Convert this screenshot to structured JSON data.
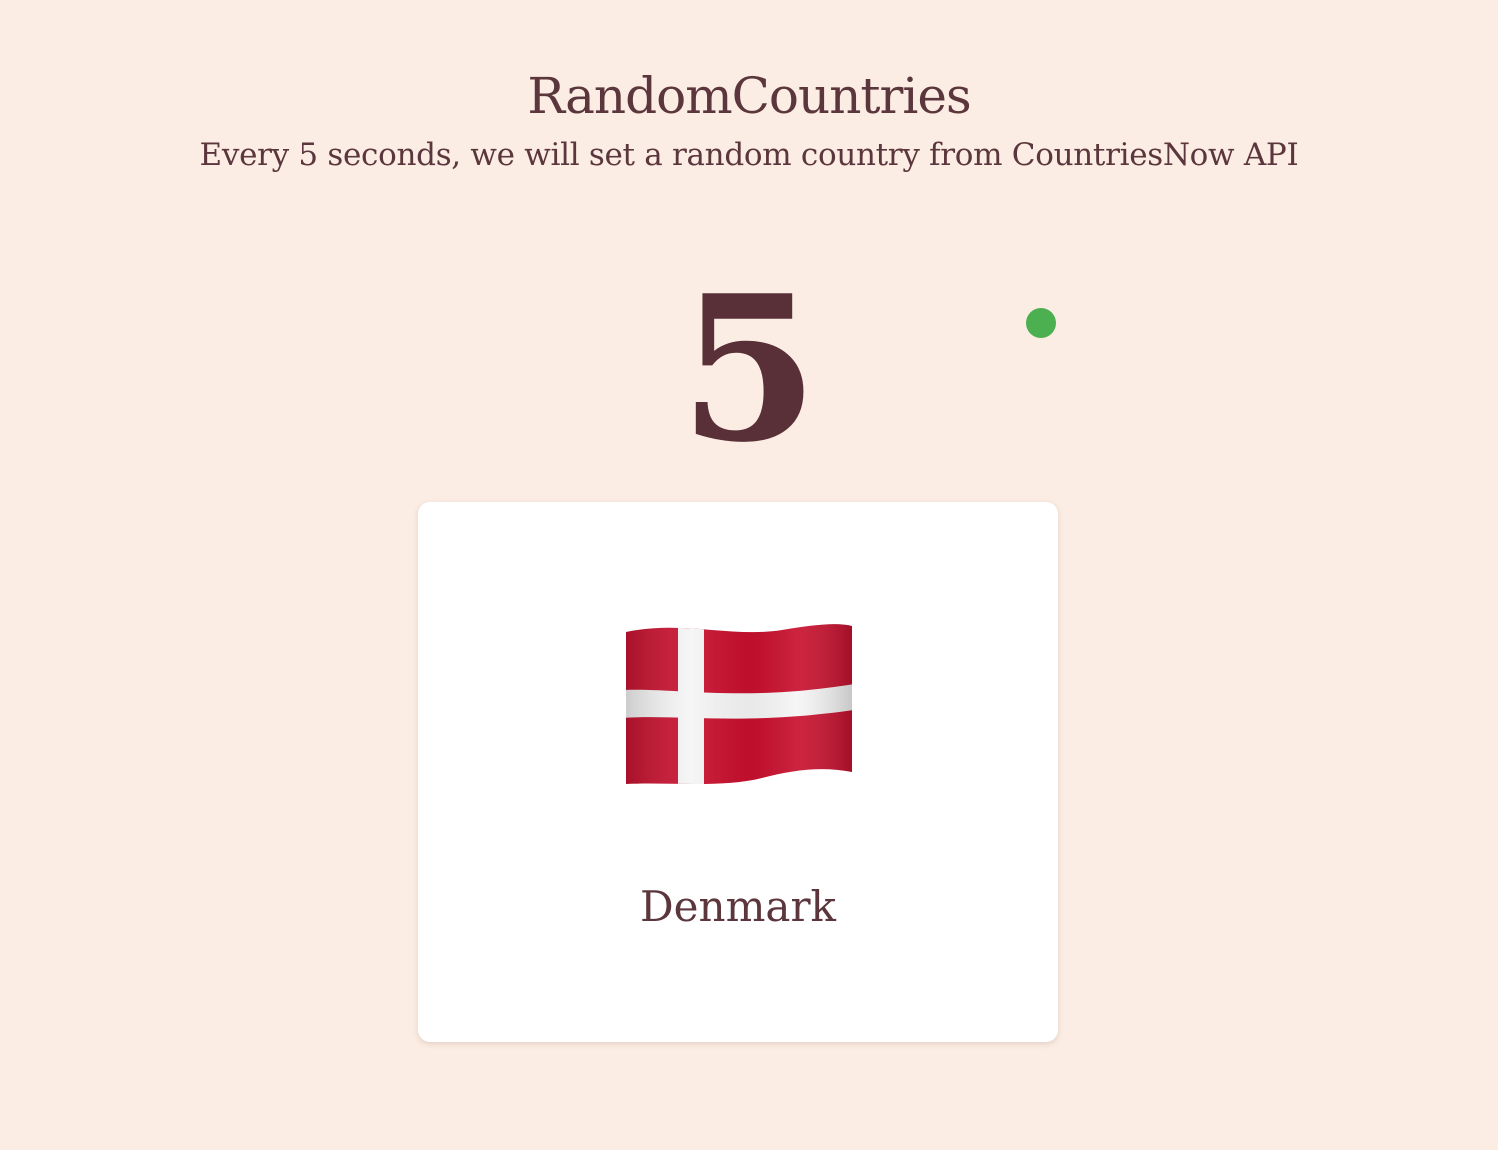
{
  "header": {
    "title": "RandomCountries",
    "subtitle": "Every 5 seconds, we will set a random country from CountriesNow API"
  },
  "countdown": {
    "value": "5"
  },
  "status": {
    "color": "#4caf50"
  },
  "country": {
    "name": "Denmark",
    "flag_icon": "denmark-flag-icon"
  },
  "colors": {
    "background": "#fbede3",
    "text": "#5b363c",
    "card": "#ffffff"
  }
}
